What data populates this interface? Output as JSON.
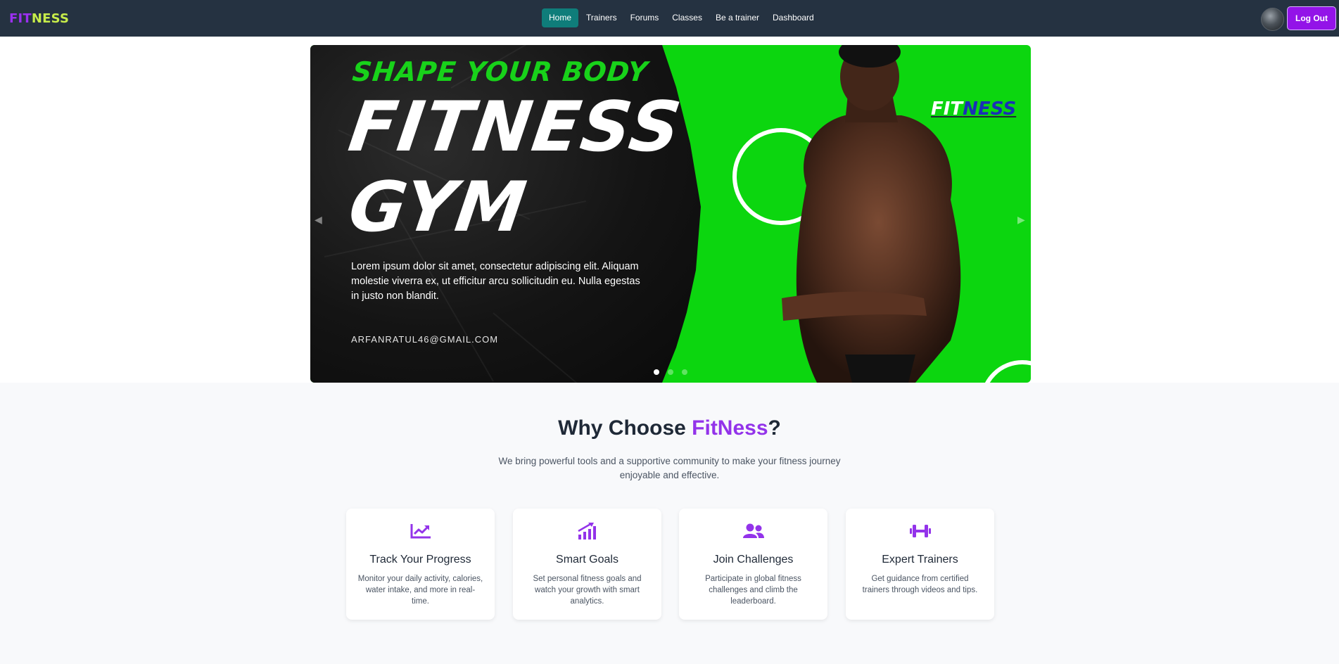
{
  "nav": {
    "logo_fit": "FIT",
    "logo_ness": "NESS",
    "links": [
      "Home",
      "Trainers",
      "Forums",
      "Classes",
      "Be a trainer",
      "Dashboard"
    ],
    "active": "Home",
    "logout": "Log Out",
    "avatar": "user-avatar"
  },
  "banner": {
    "tagline": "SHAPE YOUR BODY",
    "title_line1": "FITNESS",
    "title_line2": "GYM",
    "description": "Lorem ipsum dolor sit amet, consectetur adipiscing elit. Aliquam molestie viverra ex, ut efficitur arcu sollicitudin eu. Nulla egestas in justo non blandit.",
    "email": "ARFANRATUL46@GMAIL.COM",
    "brand_fit": "FIT",
    "brand_ness": "NESS",
    "slide_count": 3,
    "active_slide": 1
  },
  "why": {
    "title_prefix": "Why Choose ",
    "title_brand": "FitNess",
    "title_suffix": "?",
    "subtitle": "We bring powerful tools and a supportive community to make your fitness journey enjoyable and effective.",
    "features": [
      {
        "icon": "chart-line-icon",
        "title": "Track Your Progress",
        "desc": "Monitor your daily activity, calories, water intake, and more in real-time."
      },
      {
        "icon": "signal-bars-icon",
        "title": "Smart Goals",
        "desc": "Set personal fitness goals and watch your growth with smart analytics."
      },
      {
        "icon": "users-icon",
        "title": "Join Challenges",
        "desc": "Participate in global fitness challenges and climb the leaderboard."
      },
      {
        "icon": "dumbbell-icon",
        "title": "Expert Trainers",
        "desc": "Get guidance from certified trainers through videos and tips."
      }
    ]
  },
  "colors": {
    "navbar_bg": "#253241",
    "accent_purple": "#9333ea",
    "active_teal": "#0f7d7a",
    "banner_green": "#0cd60f",
    "logo_lime": "#c7ec4a"
  }
}
